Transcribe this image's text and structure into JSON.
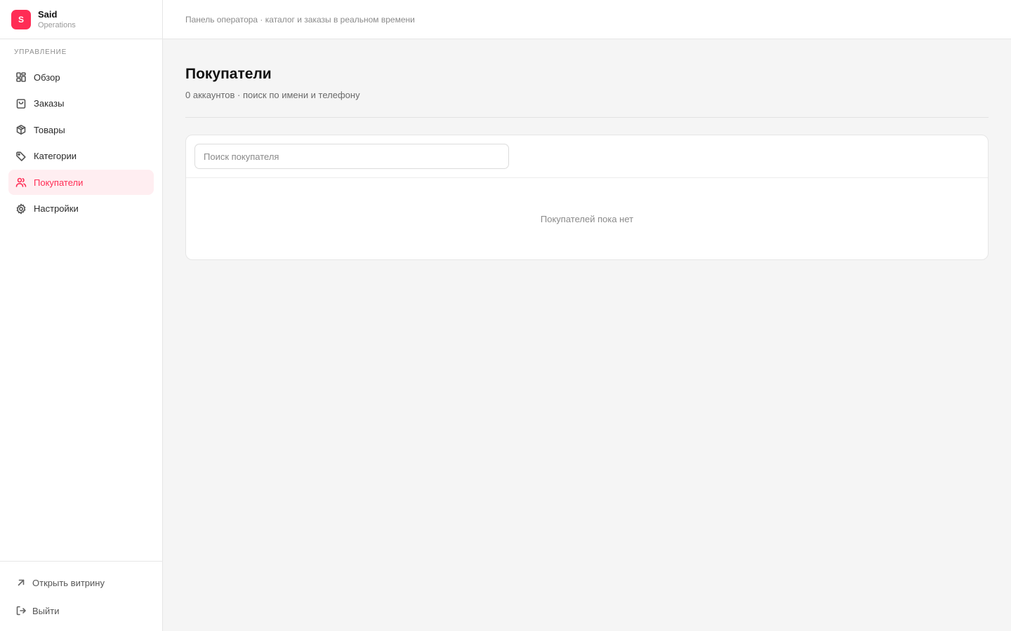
{
  "brand": {
    "logo_letter": "S",
    "name": "Said",
    "subtitle": "Operations",
    "accent": "#ff2d55"
  },
  "topbar": {
    "breadcrumb": "Панель оператора · каталог и заказы в реальном времени"
  },
  "sidebar": {
    "section_label": "УПРАВЛЕНИЕ",
    "items": [
      {
        "label": "Обзор",
        "icon": "grid-icon",
        "active": false
      },
      {
        "label": "Заказы",
        "icon": "shopping-bag-icon",
        "active": false
      },
      {
        "label": "Товары",
        "icon": "box-icon",
        "active": false
      },
      {
        "label": "Категории",
        "icon": "tag-icon",
        "active": false
      },
      {
        "label": "Покупатели",
        "icon": "users-icon",
        "active": true
      },
      {
        "label": "Настройки",
        "icon": "gear-icon",
        "active": false
      }
    ],
    "footer": {
      "open_store": "Открыть витрину",
      "logout": "Выйти"
    }
  },
  "main": {
    "title": "Покупатели",
    "subtitle": "0 аккаунтов · поиск по имени и телефону",
    "search": {
      "placeholder": "Поиск покупателя",
      "value": ""
    },
    "empty_text": "Покупателей пока нет"
  }
}
